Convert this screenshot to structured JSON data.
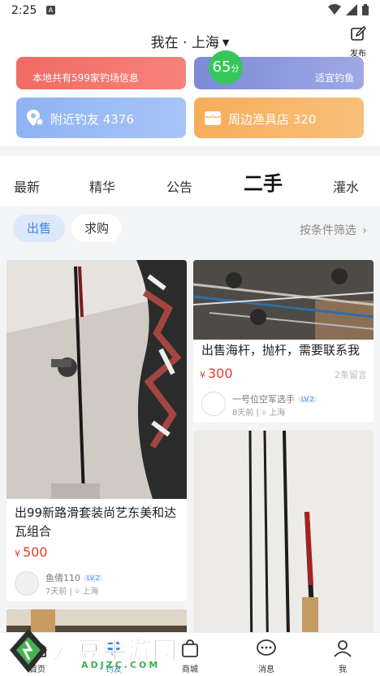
{
  "status_bar": {
    "time": "2:25"
  },
  "header": {
    "location": "我在 · 上海",
    "publish_label": "发布"
  },
  "cards": {
    "spots": {
      "subtitle": "本地共有599家钓场信息"
    },
    "weather": {
      "score": "65",
      "score_unit": "分",
      "subtitle": "适宜钓鱼"
    },
    "anglers": {
      "label": "附近钓友 4376"
    },
    "shops": {
      "label": "周边渔具店 320"
    }
  },
  "tabs": [
    "最新",
    "精华",
    "公告",
    "二手",
    "灌水"
  ],
  "active_tab": "二手",
  "filters": {
    "sell": "出售",
    "buy": "求购",
    "filter_link": "按条件筛选"
  },
  "posts": [
    {
      "title": "出99新路滑套装尚艺东美和达瓦组合",
      "price": "500",
      "currency": "¥",
      "user": "鱼倩110",
      "level": "LV.2",
      "time": "7天前",
      "city": "上海"
    },
    {
      "title": "出售海杆，抛杆，需要联系我",
      "price": "300",
      "currency": "¥",
      "comments": "2条留言",
      "user": "一号位空军选手",
      "level": "LV.2",
      "time": "8天前",
      "city": "上海"
    }
  ],
  "bottom_nav": [
    {
      "label": "首页",
      "icon": "home-icon"
    },
    {
      "label": "钓友",
      "icon": "location-icon"
    },
    {
      "label": "商城",
      "icon": "shop-icon"
    },
    {
      "label": "消息",
      "icon": "chat-icon"
    },
    {
      "label": "我",
      "icon": "person-icon"
    }
  ],
  "watermark": {
    "title": "爱豆手游网",
    "sub": "ADJZC.COM"
  }
}
